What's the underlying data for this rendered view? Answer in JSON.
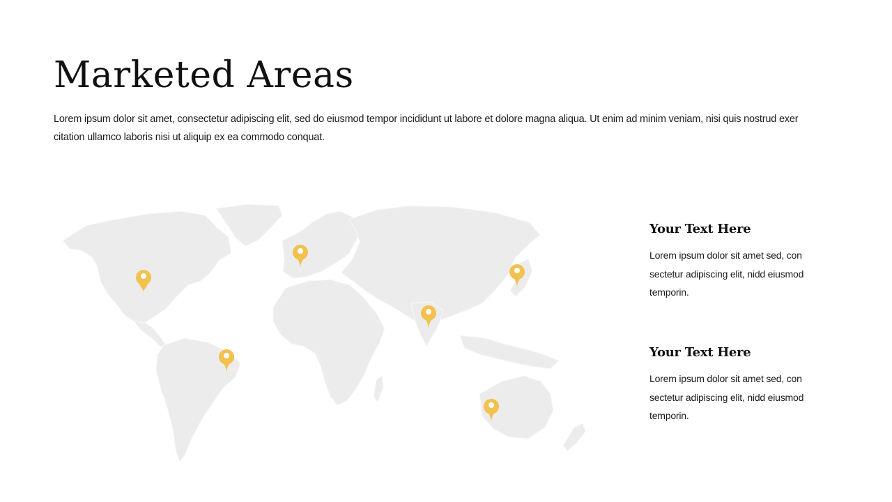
{
  "title": "Marketed Areas",
  "intro": "Lorem ipsum dolor sit amet, consectetur adipiscing elit, sed do eiusmod tempor incididunt ut labore et dolore magna aliqua. Ut enim ad minim veniam, nisi quis nostrud exer citation ullamco laboris nisi ut aliquip ex ea commodo conquat.",
  "map": {
    "land_color": "#ececec",
    "pin_color": "#f2c14e",
    "pins": [
      {
        "region": "north-america"
      },
      {
        "region": "europe"
      },
      {
        "region": "east-asia"
      },
      {
        "region": "india"
      },
      {
        "region": "south-america"
      },
      {
        "region": "australia"
      }
    ]
  },
  "blocks": [
    {
      "heading": "Your Text Here",
      "body": "Lorem ipsum dolor sit amet sed, con sectetur adipiscing elit, nidd eiusmod temporin."
    },
    {
      "heading": "Your Text Here",
      "body": "Lorem ipsum dolor sit amet sed, con sectetur adipiscing elit, nidd eiusmod temporin."
    }
  ]
}
